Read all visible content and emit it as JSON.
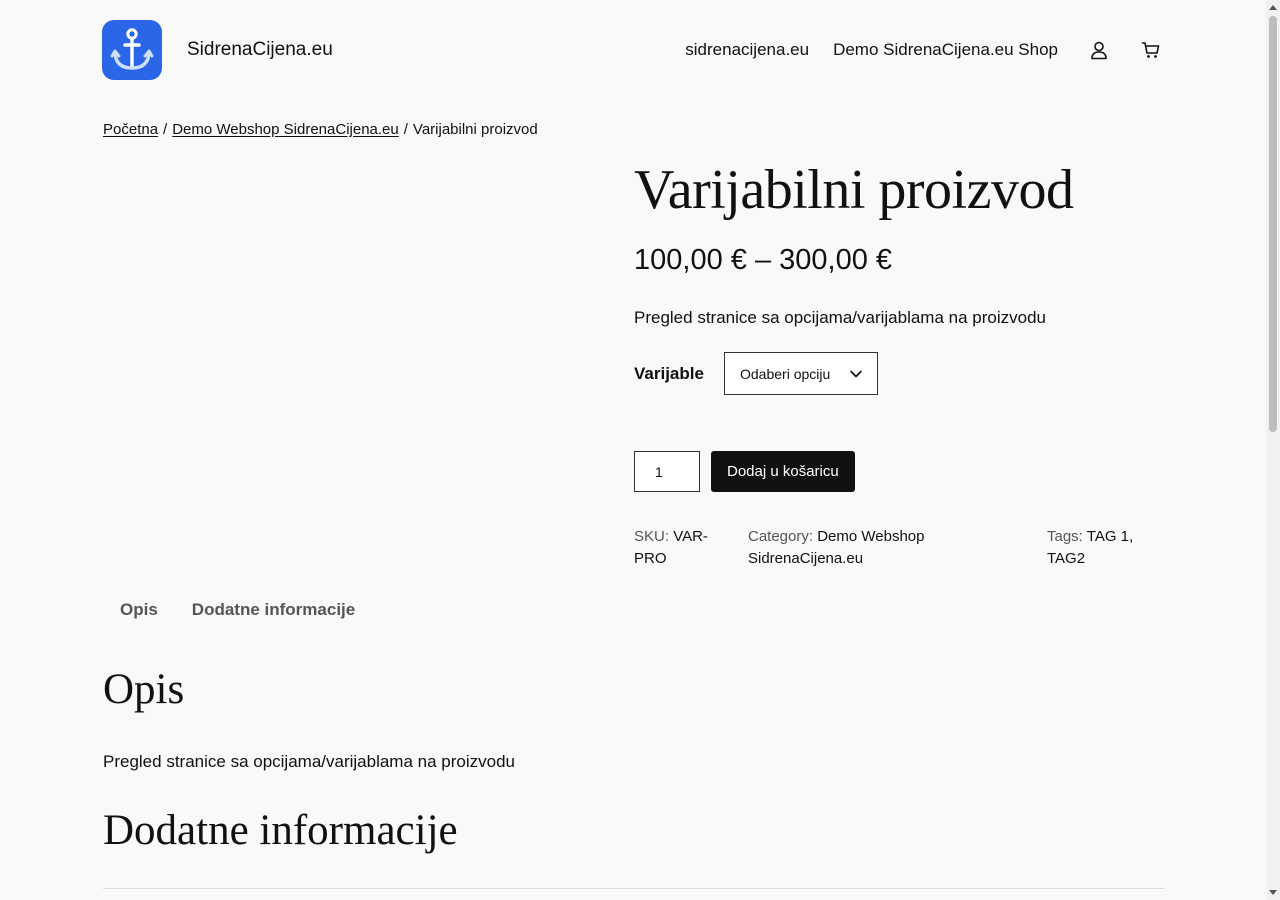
{
  "header": {
    "site_title": "SidrenaCijena.eu",
    "nav": [
      {
        "label": "sidrenacijena.eu"
      },
      {
        "label": "Demo SidrenaCijena.eu Shop"
      }
    ],
    "icons": [
      "anchor-icon",
      "user-icon",
      "cart-icon"
    ],
    "brand_color": "#2b66e8"
  },
  "breadcrumb": {
    "home": "Početna",
    "sep": "/",
    "category": "Demo Webshop SidrenaCijena.eu",
    "current": "Varijabilni proizvod"
  },
  "product": {
    "title": "Varijabilni proizvod",
    "price": "100,00 € – 300,00 €",
    "short_description": "Pregled stranice sa opcijama/varijablama na proizvodu",
    "variation_label": "Varijable",
    "variation_selected": "Odaberi opciju",
    "quantity": "1",
    "add_to_cart_label": "Dodaj u košaricu",
    "meta": {
      "sku_label": "SKU:",
      "sku_value": "VAR-PRO",
      "category_label": "Category:",
      "category_value": "Demo Webshop SidrenaCijena.eu",
      "tags_label": "Tags:",
      "tag1": "TAG 1",
      "tag_sep": ",",
      "tag2": "TAG2"
    }
  },
  "tabs": [
    {
      "label": "Opis"
    },
    {
      "label": "Dodatne informacije"
    }
  ],
  "sections": {
    "description_heading": "Opis",
    "description_text": "Pregled stranice sa opcijama/varijablama na proizvodu",
    "additional_heading": "Dodatne informacije"
  }
}
